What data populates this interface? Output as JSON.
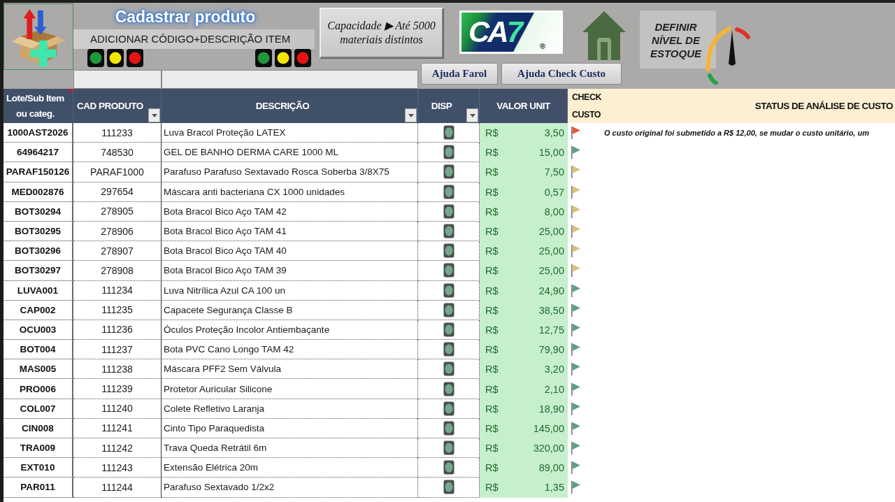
{
  "header": {
    "title": "Cadastrar produto",
    "subtitle": "ADICIONAR CÓDIGO+DESCRIÇÃO ITEM",
    "signal_groups": [
      {
        "lights": [
          {
            "color": "#1e9a3c"
          },
          {
            "color": "#f3e600"
          },
          {
            "color": "#e41414"
          }
        ]
      },
      {
        "lights": [
          {
            "color": "#1e9a3c"
          },
          {
            "color": "#f3e600"
          },
          {
            "color": "#e41414"
          }
        ]
      }
    ],
    "capacity_button": {
      "lines": [
        "Capacidade ▶ Até 5000",
        "materiais distintos"
      ]
    },
    "logo": {
      "parts": [
        {
          "text": "CA",
          "color": "#ffffff"
        },
        {
          "text": "7",
          "color": "#3ee6a0"
        }
      ],
      "mark": "®"
    },
    "help_buttons": [
      {
        "label": "Ajuda Farol"
      },
      {
        "label": "Ajuda Check Custo"
      }
    ],
    "stock_button": {
      "label": "DEFINIR NÍVEL DE ESTOQUE"
    }
  },
  "table": {
    "columns": [
      {
        "label": "Lote/Sub Item ou categ.",
        "kind": "data",
        "filter": false,
        "comment": true
      },
      {
        "label": "CAD PRODUTO",
        "kind": "data",
        "filter": true,
        "comment": false
      },
      {
        "label": "DESCRIÇÃO",
        "kind": "data",
        "filter": true,
        "comment": false
      },
      {
        "label": "DISP",
        "kind": "data",
        "filter": true,
        "comment": false
      },
      {
        "label": "VALOR UNIT",
        "kind": "data",
        "filter": false,
        "comment": false
      },
      {
        "label": "CHECK CUSTO",
        "kind": "check",
        "filter": false,
        "comment": false
      },
      {
        "label": "STATUS DE ANÁLISE DE CUSTO",
        "kind": "status",
        "filter": false,
        "comment": false
      }
    ],
    "rows": [
      {
        "lote": "1000AST2026",
        "cad_produto": "111233",
        "descricao": "Luva Bracol Proteção LATEX",
        "currency": "R$",
        "valor_unit": "3,50",
        "color": "#e2593b",
        "status": "O custo original foi submetido a R$ 12,00, se mudar o custo unitário, um"
      },
      {
        "lote": "64964217",
        "cad_produto": "748530",
        "descricao": "GEL DE BANHO DERMA CARE 1000 ML",
        "currency": "R$",
        "valor_unit": "15,00",
        "color": "#5e9e84"
      },
      {
        "lote": "PARAF150126",
        "cad_produto": "PARAF1000",
        "descricao": "Parafuso Parafuso Sextavado Rosca Soberba 3/8X75",
        "currency": "R$",
        "valor_unit": "7,50",
        "color": "#d9c27e"
      },
      {
        "lote": "MED002876",
        "cad_produto": "297654",
        "descricao": "Máscara anti bacteriana CX 1000 unidades",
        "currency": "R$",
        "valor_unit": "0,57",
        "color": "#d9c27e"
      },
      {
        "lote": "BOT30294",
        "cad_produto": "278905",
        "descricao": "Bota Bracol Bico Aço TAM 42",
        "currency": "R$",
        "valor_unit": "8,00",
        "color": "#d9c27e"
      },
      {
        "lote": "BOT30295",
        "cad_produto": "278906",
        "descricao": "Bota Bracol Bico Aço TAM 41",
        "currency": "R$",
        "valor_unit": "25,00",
        "color": "#d9c27e"
      },
      {
        "lote": "BOT30296",
        "cad_produto": "278907",
        "descricao": "Bota Bracol Bico Aço TAM 40",
        "currency": "R$",
        "valor_unit": "25,00",
        "color": "#d9c27e"
      },
      {
        "lote": "BOT30297",
        "cad_produto": "278908",
        "descricao": "Bota Bracol Bico Aço TAM 39",
        "currency": "R$",
        "valor_unit": "25,00",
        "color": "#d9c27e"
      },
      {
        "lote": "LUVA001",
        "cad_produto": "111234",
        "descricao": "Luva Nitrílica Azul CA 100 un",
        "currency": "R$",
        "valor_unit": "24,90",
        "color": "#5e9e84"
      },
      {
        "lote": "CAP002",
        "cad_produto": "111235",
        "descricao": "Capacete Segurança Classe B",
        "currency": "R$",
        "valor_unit": "38,50",
        "color": "#5e9e84"
      },
      {
        "lote": "OCU003",
        "cad_produto": "111236",
        "descricao": "Óculos Proteção Incolor Antiembaçante",
        "currency": "R$",
        "valor_unit": "12,75",
        "color": "#5e9e84"
      },
      {
        "lote": "BOT004",
        "cad_produto": "111237",
        "descricao": "Bota PVC Cano Longo TAM 42",
        "currency": "R$",
        "valor_unit": "79,90",
        "color": "#5e9e84"
      },
      {
        "lote": "MAS005",
        "cad_produto": "111238",
        "descricao": "Máscara PFF2 Sem Válvula",
        "currency": "R$",
        "valor_unit": "3,20",
        "color": "#5e9e84"
      },
      {
        "lote": "PRO006",
        "cad_produto": "111239",
        "descricao": "Protetor Auricular Silicone",
        "currency": "R$",
        "valor_unit": "2,10",
        "color": "#5e9e84"
      },
      {
        "lote": "COL007",
        "cad_produto": "111240",
        "descricao": "Colete Refletivo Laranja",
        "currency": "R$",
        "valor_unit": "18,90",
        "color": "#5e9e84"
      },
      {
        "lote": "CIN008",
        "cad_produto": "111241",
        "descricao": "Cinto Tipo Paraquedista",
        "currency": "R$",
        "valor_unit": "145,00",
        "color": "#5e9e84"
      },
      {
        "lote": "TRA009",
        "cad_produto": "111242",
        "descricao": "Trava Queda Retrátil 6m",
        "currency": "R$",
        "valor_unit": "320,00",
        "color": "#5e9e84"
      },
      {
        "lote": "EXT010",
        "cad_produto": "111243",
        "descricao": "Extensão Elétrica 20m",
        "currency": "R$",
        "valor_unit": "89,00",
        "color": "#5e9e84"
      },
      {
        "lote": "PAR011",
        "cad_produto": "111244",
        "descricao": "Parafuso Sextavado 1/2x2",
        "currency": "R$",
        "valor_unit": "1,35",
        "color": "#5e9e84"
      }
    ]
  }
}
